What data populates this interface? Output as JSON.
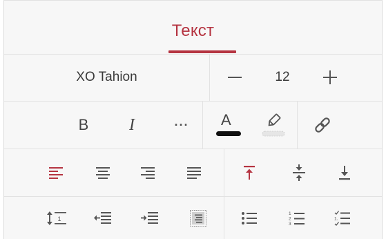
{
  "tab": {
    "label": "Текст"
  },
  "font": {
    "name": "XO Tahion",
    "size": "12"
  },
  "format": {
    "bold": "B",
    "italic": "I",
    "more": "···",
    "text_color_letter": "A"
  },
  "colors": {
    "accent": "#b53441",
    "icon": "#4a4a4a",
    "text_color_bar": "#111111"
  },
  "icons": {
    "row3": [
      "align-left-icon",
      "align-center-icon",
      "align-right-icon",
      "align-justify-icon",
      "valign-top-icon",
      "valign-middle-icon",
      "valign-bottom-icon"
    ],
    "row4": [
      "line-spacing-icon",
      "decrease-indent-icon",
      "increase-indent-icon",
      "wrap-text-icon",
      "bullet-list-icon",
      "numbered-list-icon",
      "checklist-icon"
    ]
  }
}
